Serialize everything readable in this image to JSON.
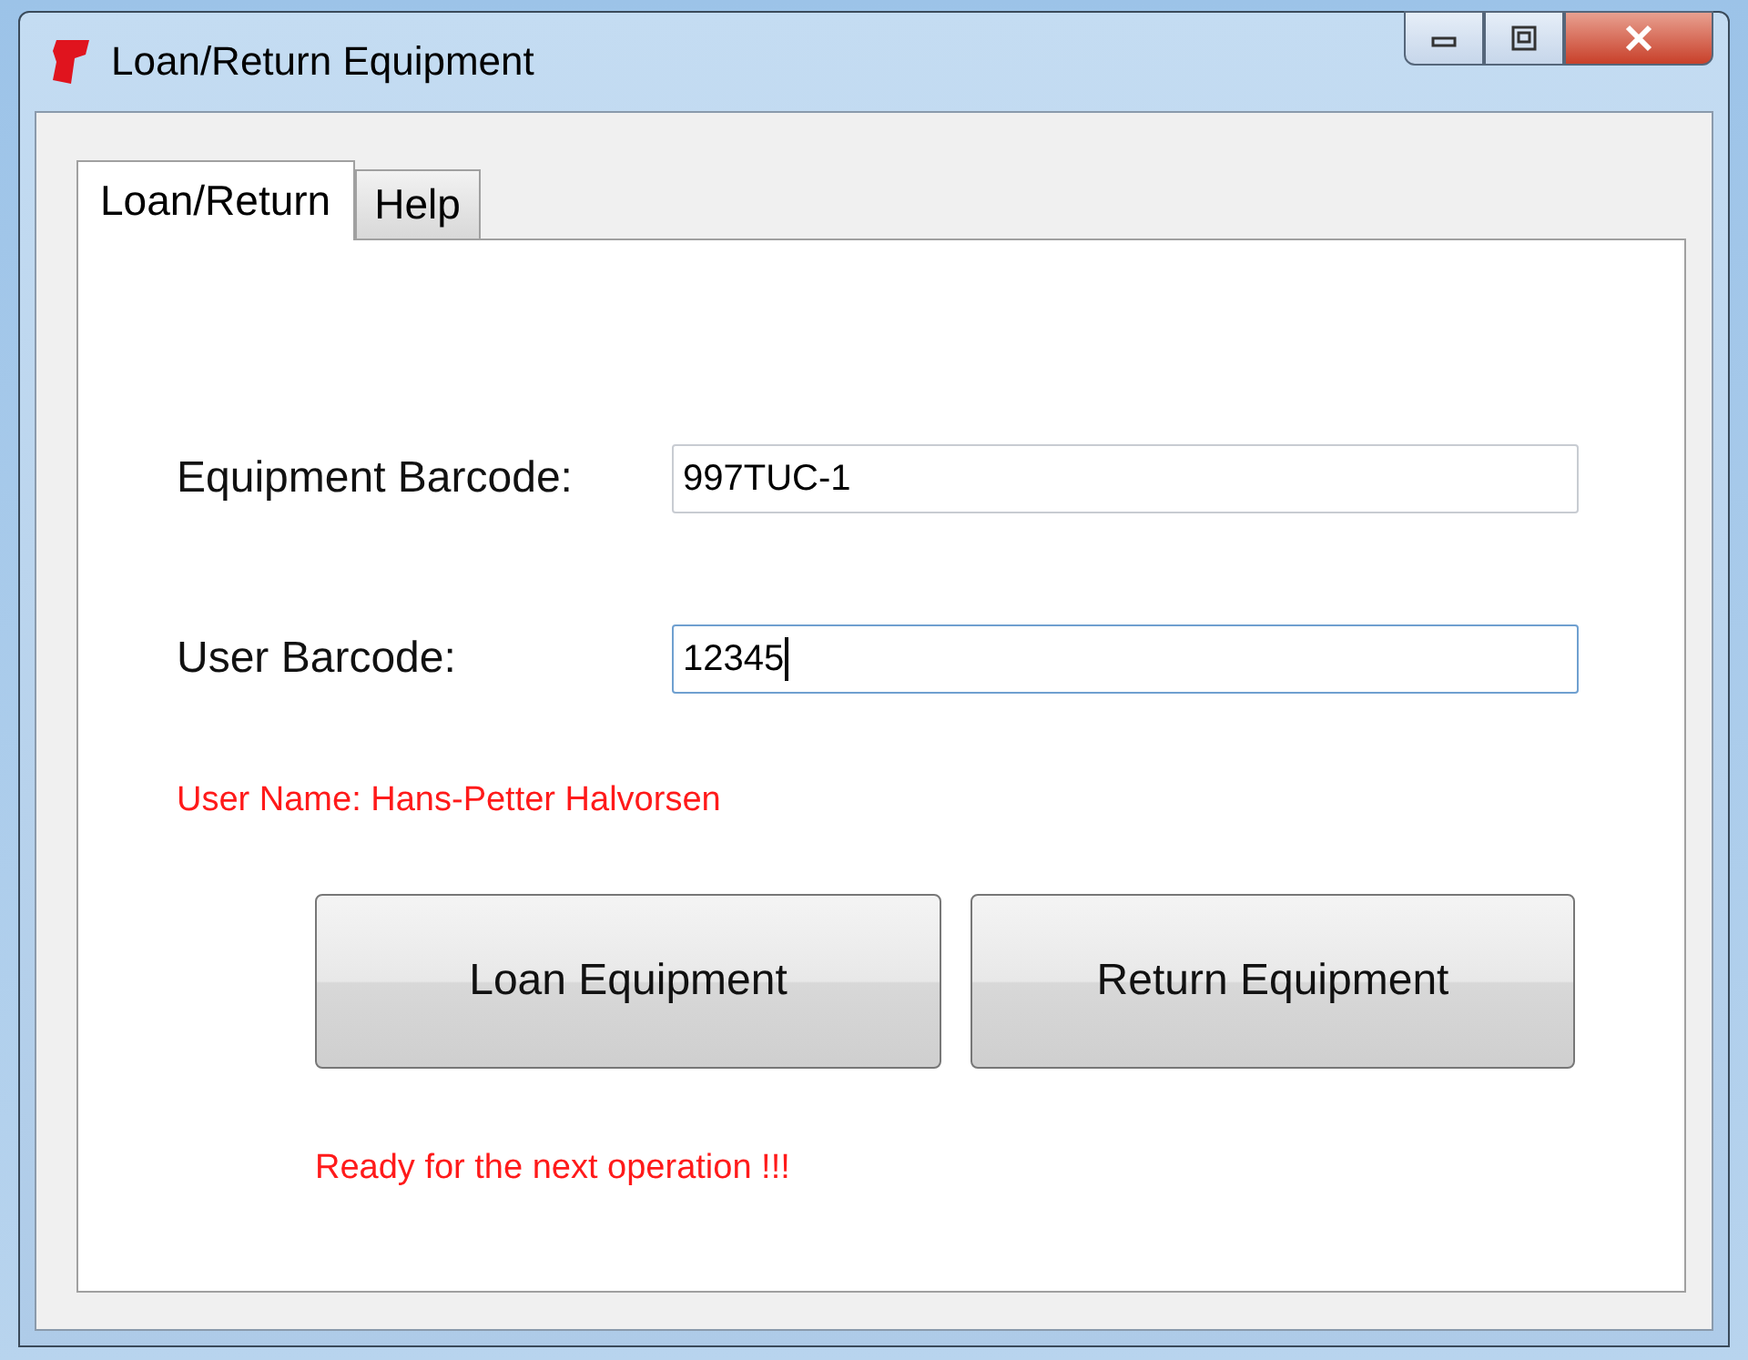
{
  "window": {
    "title": "Loan/Return Equipment"
  },
  "tabs": [
    {
      "label": "Loan/Return",
      "selected": true
    },
    {
      "label": "Help",
      "selected": false
    }
  ],
  "fields": [
    {
      "label": "Equipment Barcode:",
      "value": "997TUC-1",
      "focused": false
    },
    {
      "label": "User Barcode:",
      "value": "12345",
      "focused": true
    }
  ],
  "user_name": "User Name: Hans-Petter Halvorsen",
  "buttons": [
    "Loan Equipment",
    "Return Equipment"
  ],
  "status": "Ready for the next operation !!!"
}
